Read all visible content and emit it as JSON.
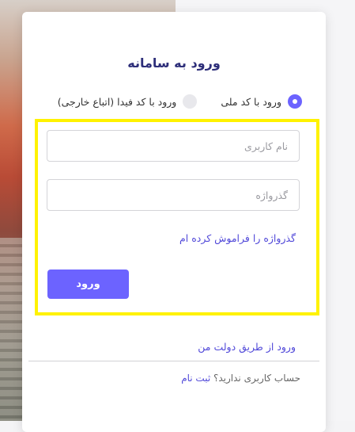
{
  "login": {
    "title": "ورود به سامانه",
    "auth_options": [
      {
        "label": "ورود با کد ملی",
        "selected": true
      },
      {
        "label": "ورود با کد فیدا (اتباع خارجی)",
        "selected": false
      }
    ],
    "username_placeholder": "نام کاربری",
    "password_placeholder": "گذرواژه",
    "forgot_password": "گذرواژه را فراموش کرده ام",
    "submit_label": "ورود",
    "gov_login": "ورود از طریق دولت من",
    "no_account_text": "حساب کاربری ندارید؟",
    "signup_link": "ثبت نام"
  },
  "colors": {
    "accent": "#6c63ff",
    "link": "#5149d9",
    "title": "#2e2f7a",
    "highlight_border": "#fff200"
  }
}
